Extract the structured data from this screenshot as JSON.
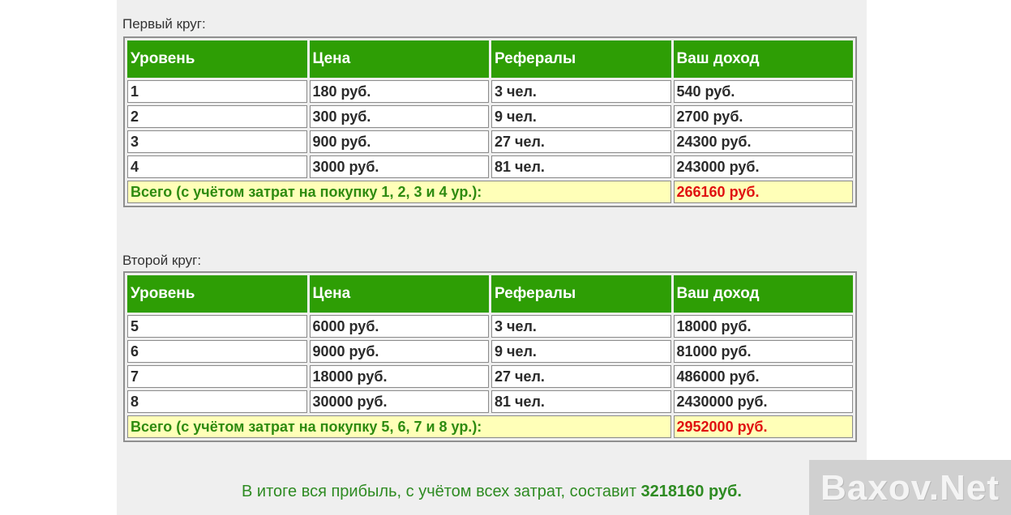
{
  "round1": {
    "caption": "Первый круг:",
    "headers": [
      "Уровень",
      "Цена",
      "Рефералы",
      "Ваш доход"
    ],
    "rows": [
      [
        "1",
        "180 руб.",
        "3 чел.",
        "540 руб."
      ],
      [
        "2",
        "300 руб.",
        "9 чел.",
        "2700 руб."
      ],
      [
        "3",
        "900 руб.",
        "27 чел.",
        "24300 руб."
      ],
      [
        "4",
        "3000 руб.",
        "81 чел.",
        "243000 руб."
      ]
    ],
    "total_label": "Всего (с учётом затрат на покупку 1, 2, 3 и 4 ур.):",
    "total_value": "266160 руб."
  },
  "round2": {
    "caption": "Второй круг:",
    "headers": [
      "Уровень",
      "Цена",
      "Рефералы",
      "Ваш доход"
    ],
    "rows": [
      [
        "5",
        "6000 руб.",
        "3 чел.",
        "18000 руб."
      ],
      [
        "6",
        "9000 руб.",
        "9 чел.",
        "81000 руб."
      ],
      [
        "7",
        "18000 руб.",
        "27 чел.",
        "486000 руб."
      ],
      [
        "8",
        "30000 руб.",
        "81 чел.",
        "2430000 руб."
      ]
    ],
    "total_label": "Всего (с учётом затрат на покупку 5, 6, 7 и 8 ур.):",
    "total_value": "2952000 руб."
  },
  "summary": {
    "text": "В итоге вся прибыль, с учётом всех затрат, составит ",
    "amount": "3218160 руб."
  },
  "watermark": "Baxov.Net",
  "colors": {
    "header_green": "#2e9e05",
    "total_bg": "#ffffb8",
    "total_label": "#2e8b10",
    "total_value": "#e01010",
    "summary_text": "#2e8b22"
  }
}
